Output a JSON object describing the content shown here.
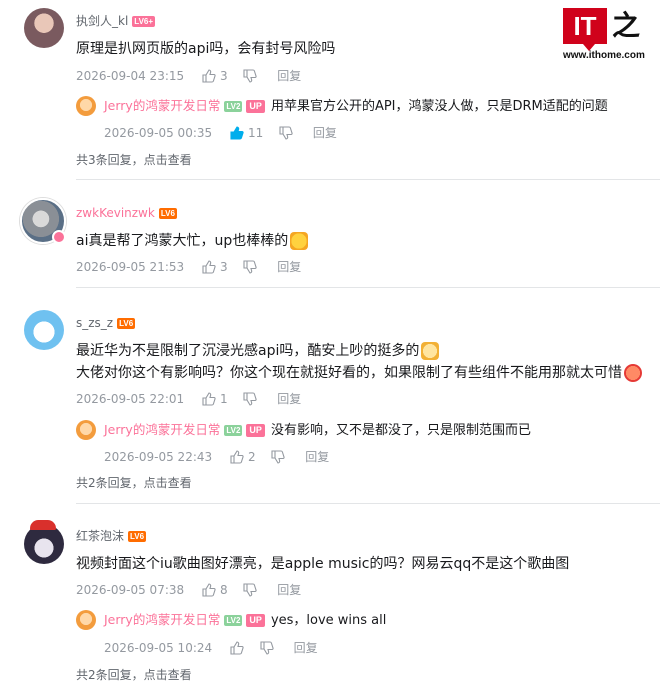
{
  "watermark": {
    "logo": "IT",
    "char": "之家",
    "url": "www.ithome.com"
  },
  "comments": [
    {
      "user": "执剑人_kl",
      "level": "LV6+",
      "level_color": "#fb7299",
      "text": "原理是扒网页版的api吗，会有封号风险吗",
      "time": "2026-09-04 23:15",
      "likes": "3",
      "reply_label": "回复",
      "reply": {
        "user": "Jerry的鸿蒙开发日常",
        "level": "LV2",
        "level_color": "#8bd29b",
        "up": "UP",
        "text": "用苹果官方公开的API，鸿蒙没人做，只是DRM适配的问题",
        "time": "2026-09-05 00:35",
        "likes": "11"
      },
      "more": "共3条回复，点击查看"
    },
    {
      "user": "zwkKevinzwk",
      "level": "LV6",
      "level_color": "#ff6c00",
      "text": "ai真是帮了鸿蒙大忙，up也棒棒的",
      "time": "2026-09-05 21:53",
      "likes": "3",
      "reply_label": "回复"
    },
    {
      "user": "s_zs_z",
      "level": "LV6",
      "level_color": "#ff6c00",
      "text": "最近华为不是限制了沉浸光感api吗，酷安上吵的挺多的",
      "text2": "大佬对你这个有影响吗？你这个现在就挺好看的，如果限制了有些组件不能用那就太可惜",
      "time": "2026-09-05 22:01",
      "likes": "1",
      "reply_label": "回复",
      "reply": {
        "user": "Jerry的鸿蒙开发日常",
        "level": "LV2",
        "level_color": "#8bd29b",
        "up": "UP",
        "text": "没有影响，又不是都没了，只是限制范围而已",
        "time": "2026-09-05 22:43",
        "likes": "2"
      },
      "more": "共2条回复，点击查看"
    },
    {
      "user": "红茶泡沫",
      "level": "LV6",
      "level_color": "#ff6c00",
      "text": "视频封面这个iu歌曲图好漂亮，是apple music的吗？网易云qq不是这个歌曲图",
      "time": "2026-09-05 07:38",
      "likes": "8",
      "reply_label": "回复",
      "reply": {
        "user": "Jerry的鸿蒙开发日常",
        "level": "LV2",
        "level_color": "#8bd29b",
        "up": "UP",
        "text": "yes，love wins all",
        "time": "2026-09-05 10:24",
        "likes": ""
      },
      "more": "共2条回复，点击查看"
    }
  ]
}
